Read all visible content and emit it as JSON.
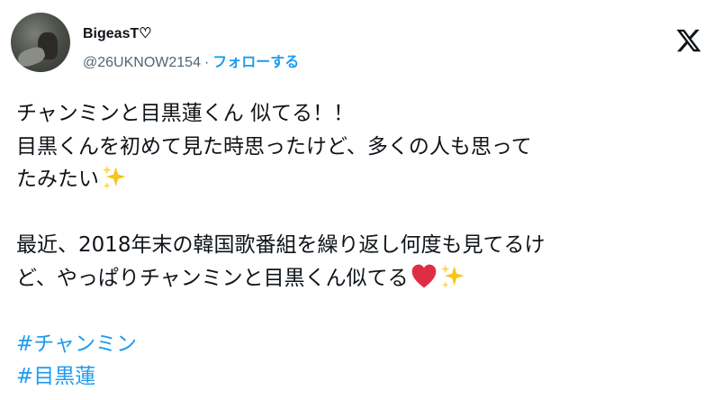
{
  "author": {
    "display_name": "BigeasT♡",
    "handle": "@26UKNOW2154",
    "separator": "·",
    "follow_label": "フォローする"
  },
  "platform_icon": "x-logo-icon",
  "tweet": {
    "lines": [
      "チャンミンと目黒蓮くん 似てる！！",
      "目黒くんを初めて見た時思ったけど、多くの人も思って",
      "たみたい",
      "",
      "最近、2018年末の韓国歌番組を繰り返し何度も見てるけ",
      "ど、やっぱりチャンミンと目黒くん似てる"
    ],
    "hashtags": [
      "#チャンミン",
      "#目黒蓮"
    ]
  },
  "icons": {
    "sparkles": "sparkles-emoji-icon",
    "heart": "red-heart-emoji-icon"
  },
  "colors": {
    "accent": "#1d9bf0",
    "text": "#0f1419",
    "secondary": "#536471",
    "heart": "#e0245e",
    "sparkle": "#f5c518"
  }
}
